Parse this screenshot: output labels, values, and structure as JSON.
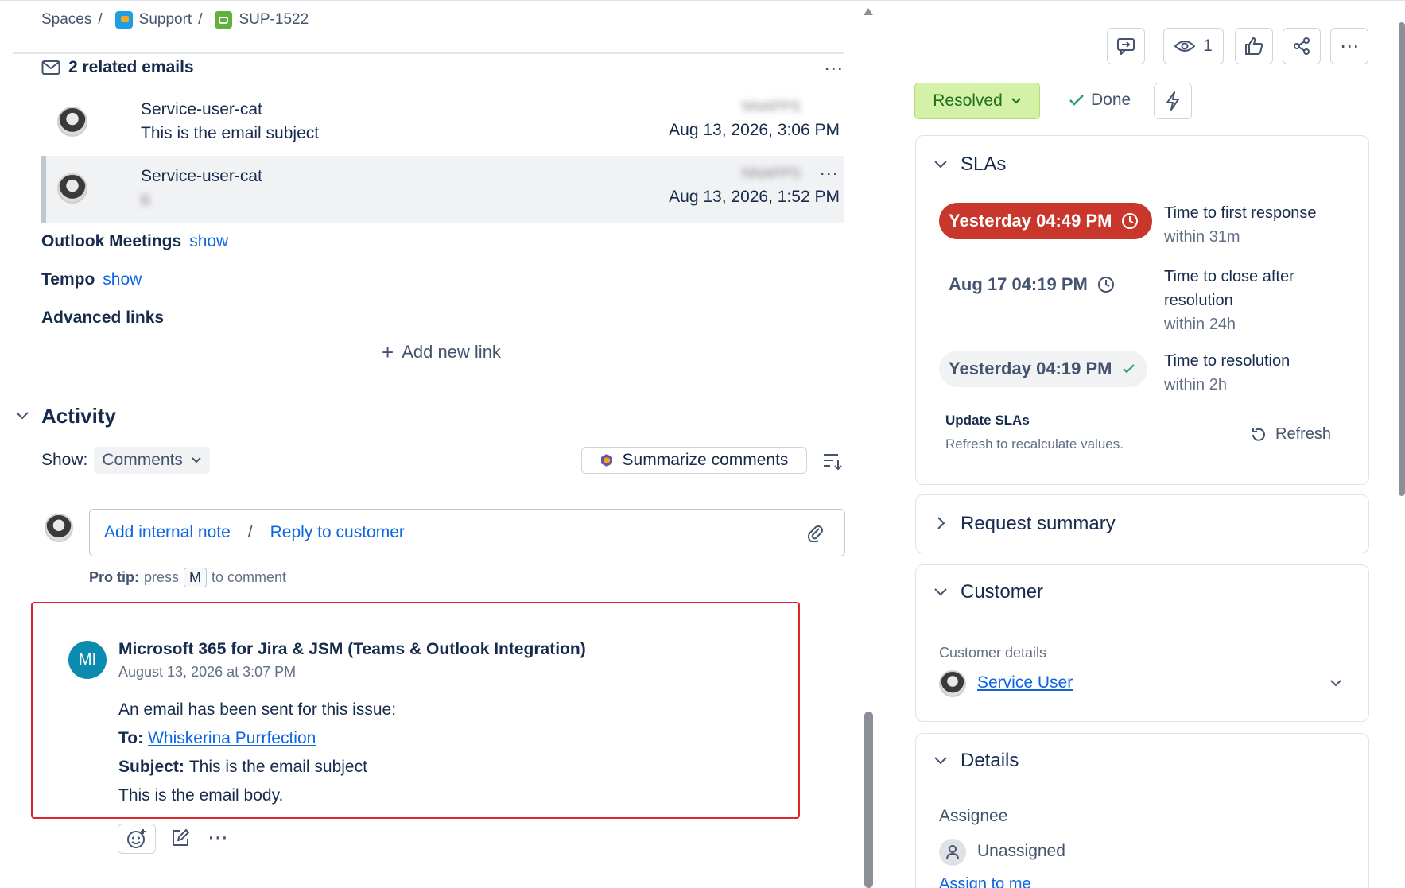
{
  "breadcrumb": {
    "spaces": "Spaces",
    "project": "Support",
    "issue_key": "SUP-1522",
    "sep": "/"
  },
  "related_emails": {
    "title": "2 related emails",
    "items": [
      {
        "sender": "Service-user-cat",
        "subject": "This is the email subject",
        "blurred_tag": "NNAPPS",
        "date": "Aug 13, 2026, 3:06 PM"
      },
      {
        "sender": "Service-user-cat",
        "subject": "B",
        "blurred_tag": "NNAPPS",
        "date": "Aug 13, 2026, 1:52 PM"
      }
    ]
  },
  "sections": {
    "outlook_label": "Outlook Meetings",
    "outlook_link": "show",
    "tempo_label": "Tempo",
    "tempo_link": "show",
    "advanced_links": "Advanced links",
    "add_new_link": "Add new link"
  },
  "activity": {
    "title": "Activity",
    "show_label": "Show:",
    "show_value": "Comments",
    "summarize": "Summarize comments",
    "add_internal_note": "Add internal note",
    "slash": "/",
    "reply_to_customer": "Reply to customer",
    "pro_tip_bold": "Pro tip:",
    "pro_tip_press": "press",
    "pro_tip_key": "M",
    "pro_tip_rest": "to comment"
  },
  "comment": {
    "avatar_initials": "MI",
    "author": "Microsoft 365 for Jira & JSM (Teams & Outlook Integration)",
    "timestamp": "August 13, 2026 at 3:07 PM",
    "line1": "An email has been sent for this issue:",
    "to_label": "To:",
    "to_value": "Whiskerina Purrfection",
    "subject_label": "Subject:",
    "subject_value": "This is the email subject",
    "body": "This is the email body."
  },
  "toolbar": {
    "watch_count": "1"
  },
  "status": {
    "value": "Resolved",
    "resolution": "Done"
  },
  "slas": {
    "title": "SLAs",
    "items": [
      {
        "time": "Yesterday 04:49 PM",
        "label_line1": "Time to first response",
        "label_line2": "within 31m",
        "state": "breached"
      },
      {
        "time": "Aug 17 04:19 PM",
        "label_line1": "Time to close after",
        "label_line1b": "resolution",
        "label_line2": "within 24h",
        "state": "running"
      },
      {
        "time": "Yesterday 04:19 PM",
        "label_line1": "Time to resolution",
        "label_line2": "within 2h",
        "state": "met"
      }
    ],
    "update_title": "Update SLAs",
    "update_desc": "Refresh to recalculate values.",
    "refresh": "Refresh"
  },
  "request_summary": {
    "title": "Request summary"
  },
  "customer": {
    "title": "Customer",
    "details_label": "Customer details",
    "name": "Service User"
  },
  "details": {
    "title": "Details",
    "assignee_label": "Assignee",
    "assignee_value": "Unassigned",
    "assign_to_me": "Assign to me"
  },
  "colors": {
    "link": "#0c66e4",
    "resolved_bg": "#d3f1a7",
    "breached": "#c9372c",
    "met_bg": "#f1f2f4",
    "highlight_border": "#e2242a",
    "mi_avatar": "#0b8bb0"
  }
}
